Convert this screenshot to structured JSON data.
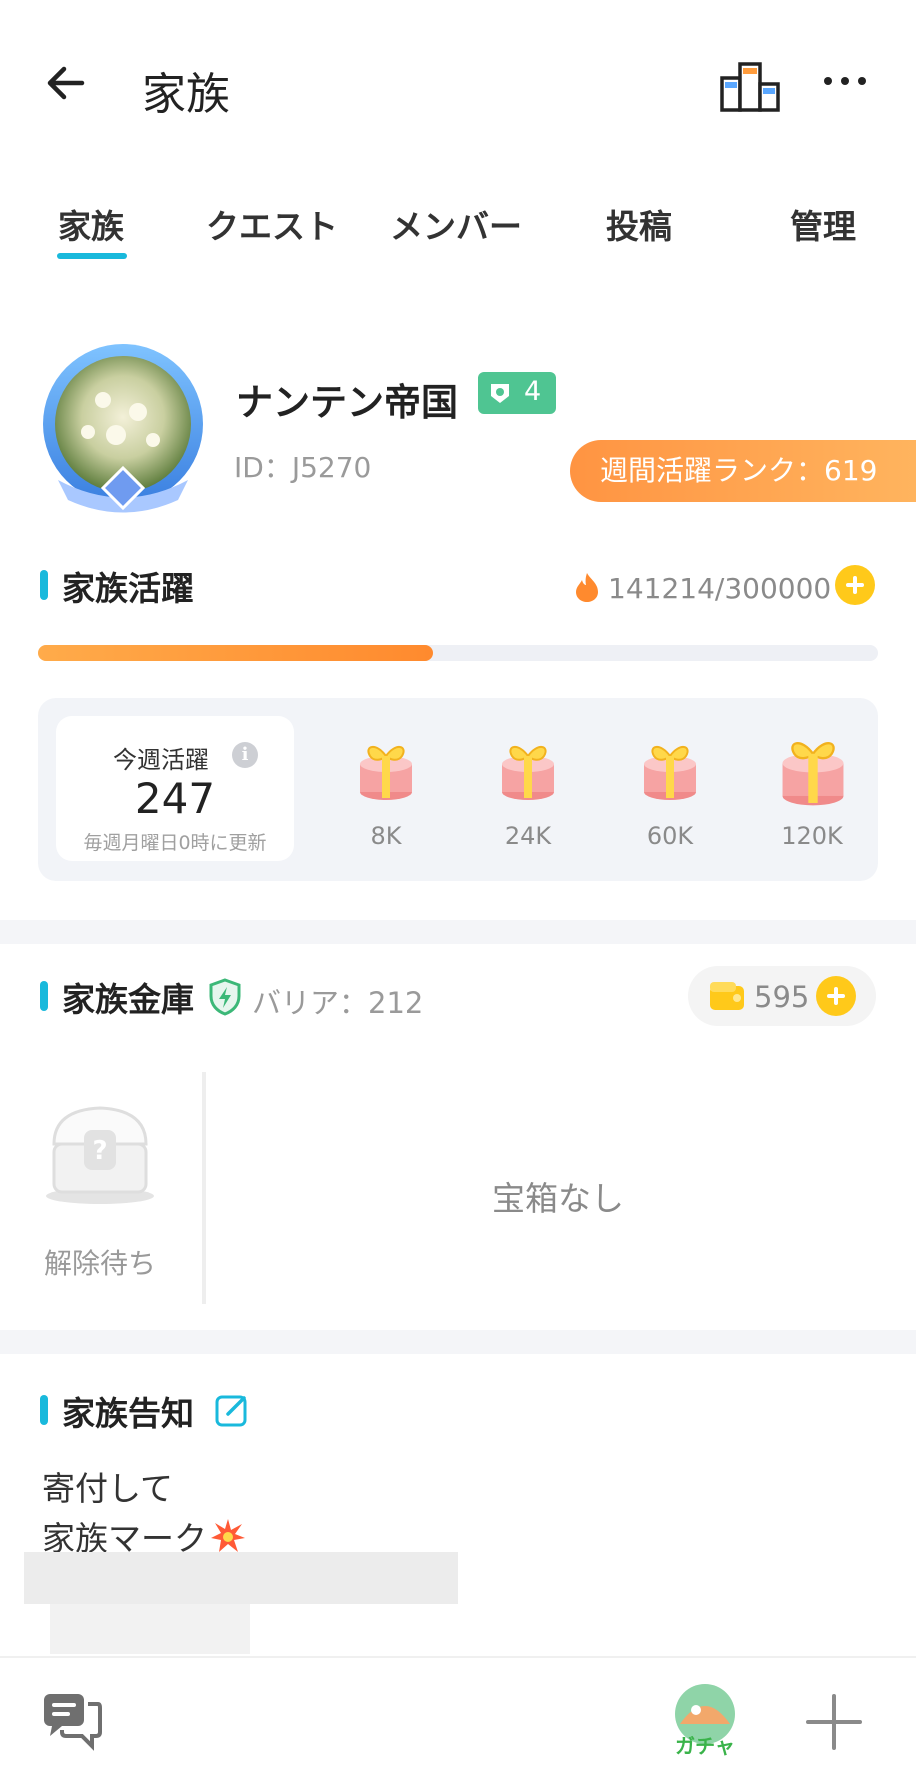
{
  "header": {
    "title": "家族"
  },
  "tabs": [
    {
      "label": "家族",
      "active": true
    },
    {
      "label": "クエスト"
    },
    {
      "label": "メンバー"
    },
    {
      "label": "投稿"
    },
    {
      "label": "管理"
    }
  ],
  "family": {
    "name": "ナンテン帝国",
    "level": "4",
    "id": "ID：J5270",
    "weekly_rank": "週間活躍ランク：619"
  },
  "activity": {
    "title": "家族活躍",
    "count": "141214/300000",
    "progress_fraction": 0.47,
    "week_label": "今週活躍",
    "week_value": "247",
    "week_note": "毎週月曜日0時に更新",
    "rewards": [
      {
        "label": "8K"
      },
      {
        "label": "24K"
      },
      {
        "label": "60K"
      },
      {
        "label": "120K"
      }
    ]
  },
  "vault": {
    "title": "家族金庫",
    "barrier": "バリア：212",
    "coins": "595",
    "chest_label": "解除待ち",
    "empty_text": "宝箱なし"
  },
  "notice": {
    "title": "家族告知",
    "lines": [
      "寄付して",
      "家族マーク"
    ]
  },
  "bottom": {
    "gacha_label": "ガチャ"
  },
  "colors": {
    "accent": "#19b9dc",
    "rank_orange": "#ff9442",
    "level_green": "#4fc592",
    "coin_yellow": "#ffc91a"
  },
  "icons": [
    "back-arrow-icon",
    "ranking-icon",
    "more-icon",
    "level-icon",
    "flame-icon",
    "info-icon",
    "gift-icon",
    "shield-icon",
    "coin-icon",
    "chest-icon",
    "edit-icon",
    "burst-icon",
    "chat-icon",
    "gacha-icon",
    "plus-icon"
  ]
}
